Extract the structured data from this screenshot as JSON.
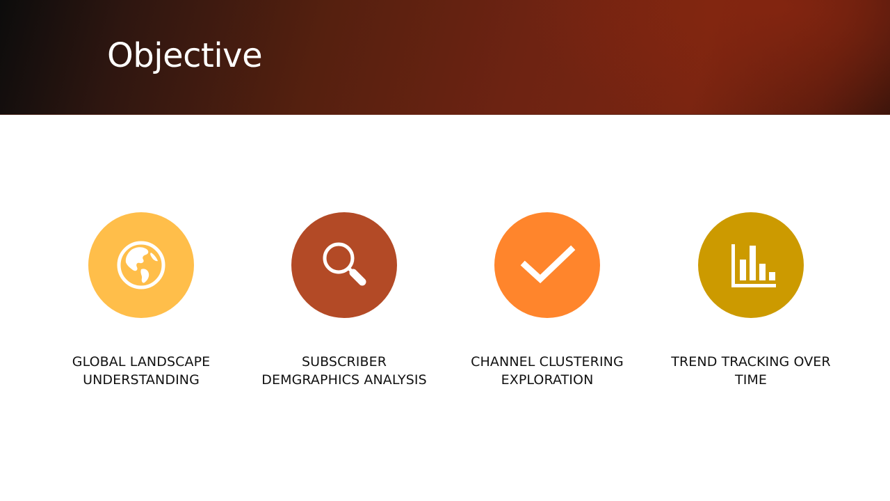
{
  "slide": {
    "title": "Objective"
  },
  "objectives": [
    {
      "icon": "globe-icon",
      "color": "#FFBE4A",
      "label_lines": [
        "GLOBAL LANDSCAPE",
        "UNDERSTANDING"
      ]
    },
    {
      "icon": "magnifier-icon",
      "color": "#B34A26",
      "label_lines": [
        "SUBSCRIBER",
        "DEMGRAPHICS ANALYSIS"
      ]
    },
    {
      "icon": "checkmark-icon",
      "color": "#FF852C",
      "label_lines": [
        "CHANNEL CLUSTERING",
        "EXPLORATION"
      ]
    },
    {
      "icon": "bar-chart-icon",
      "color": "#CC9A00",
      "label_lines": [
        "TREND TRACKING OVER",
        "TIME"
      ]
    }
  ]
}
